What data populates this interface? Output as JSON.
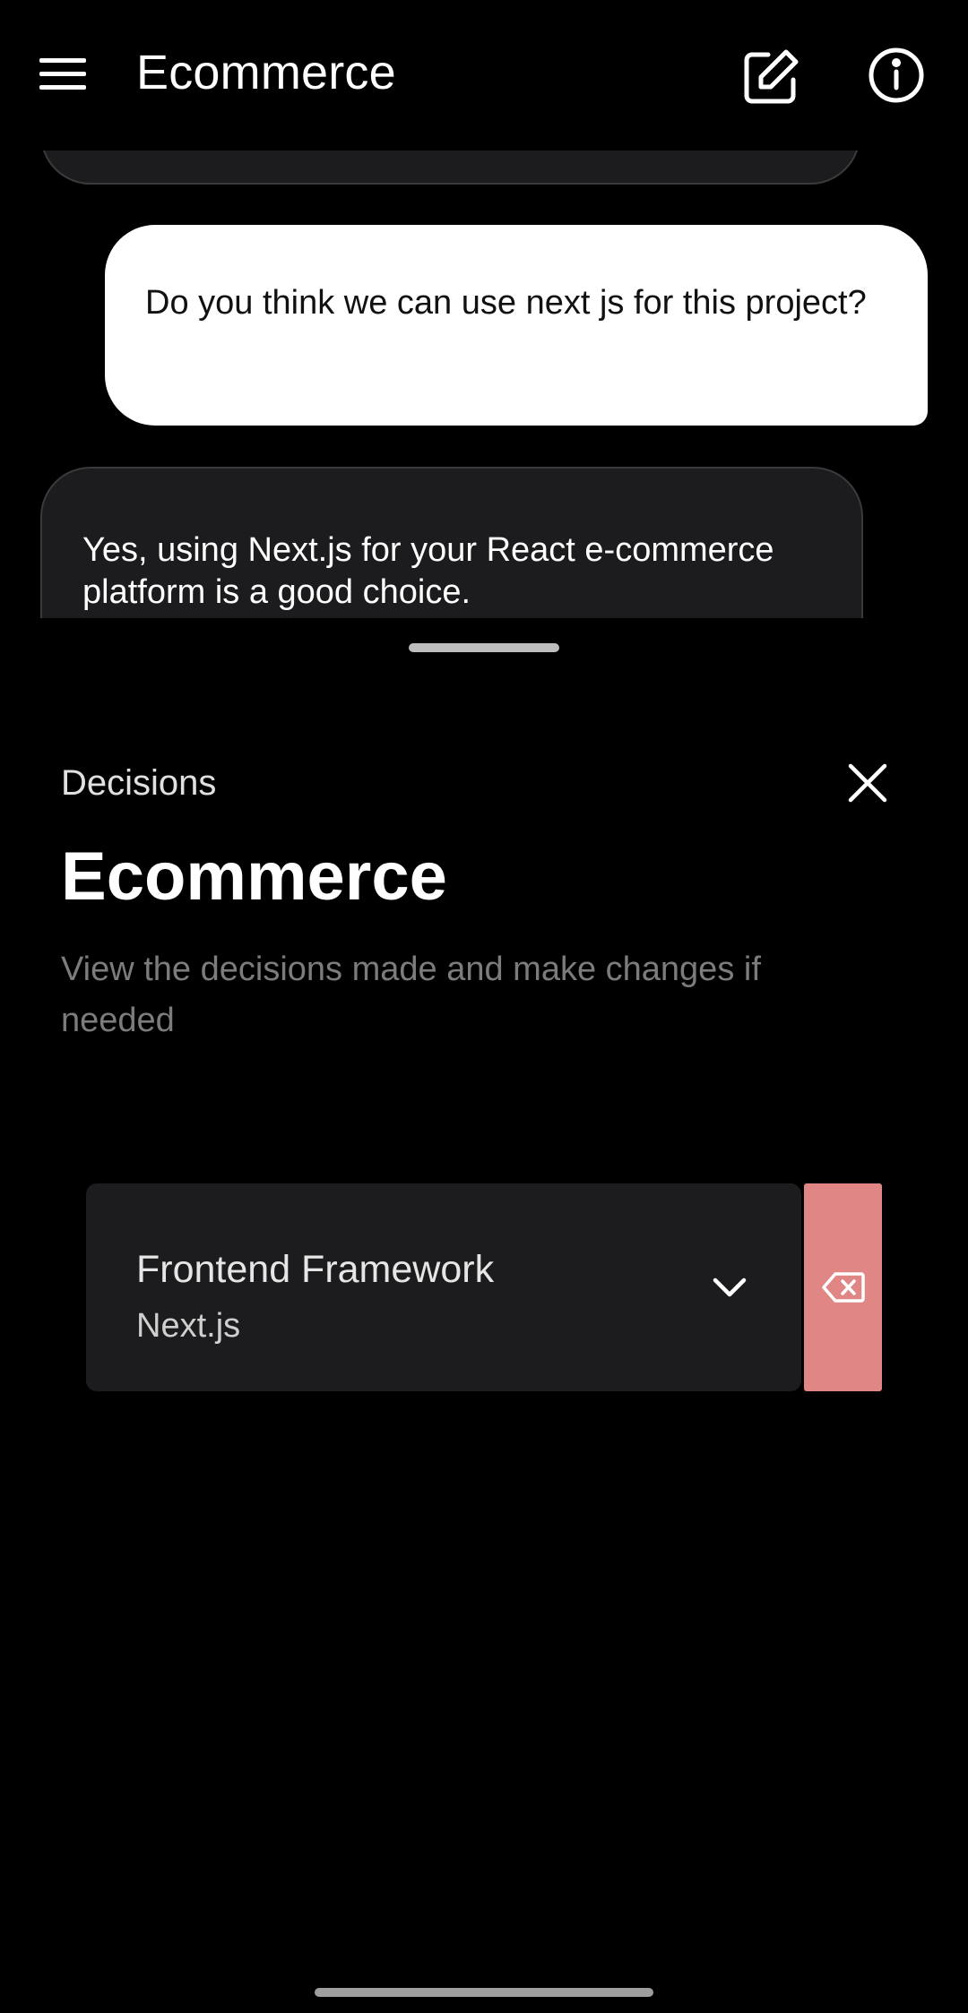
{
  "app_bar": {
    "title": "Ecommerce",
    "icons": {
      "menu": "menu-icon",
      "edit": "edit-icon",
      "info": "info-icon"
    }
  },
  "chat": {
    "messages": [
      {
        "role": "user",
        "text": "Do you think we can use next js for this project?"
      },
      {
        "role": "assistant",
        "text": "Yes, using Next.js for your React e-commerce platform is a good choice."
      }
    ]
  },
  "sheet": {
    "label": "Decisions",
    "title": "Ecommerce",
    "subtitle": "View the decisions made and make changes if needed",
    "decisions": [
      {
        "title": "Frontend Framework",
        "value": "Next.js"
      }
    ],
    "icons": {
      "close": "close-icon",
      "expand": "chevron-down-icon",
      "delete": "backspace-icon"
    }
  },
  "colors": {
    "background": "#000000",
    "user_bubble": "#ffffff",
    "assistant_bubble": "#1c1c1e",
    "card": "#1c1c1e",
    "delete_action": "#e08684",
    "muted_text": "#7c7c7c"
  }
}
